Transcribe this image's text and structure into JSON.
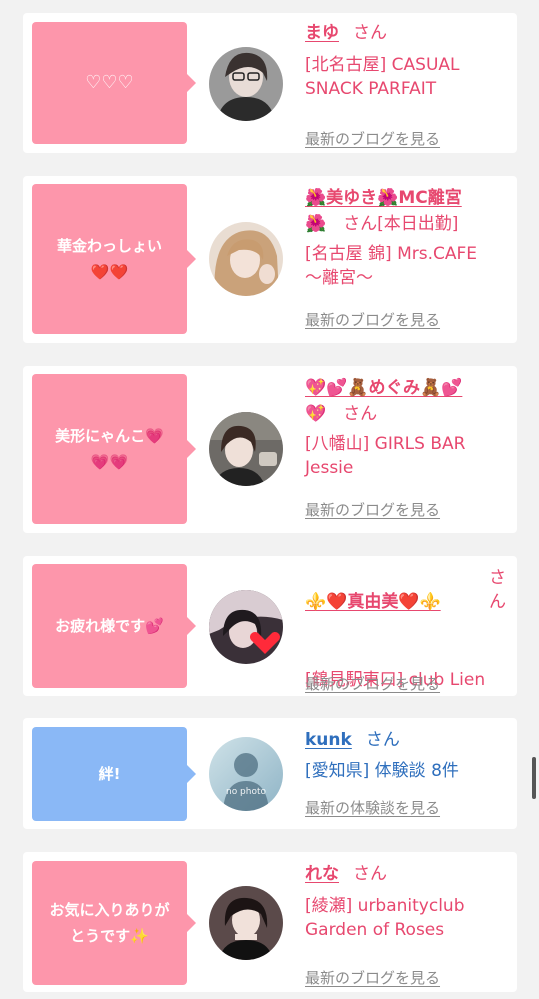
{
  "entries": [
    {
      "message": "♡♡♡",
      "name": "まゆ",
      "honorific": "さん",
      "shop": "[北名古屋] CASUAL\nSNACK PARFAIT",
      "link": "最新のブログを見る"
    },
    {
      "message": "華金わっしょい\n❤️❤️",
      "name": "🌺美ゆき🌺MC離宮",
      "honorific": "🌺　さん[本日出勤]",
      "shop": "[名古屋 錦] Mrs.CAFE\n〜離宮〜",
      "link": "最新のブログを見る"
    },
    {
      "message": "美形にゃんこ💗\n💗💗",
      "name": "💖💕🧸めぐみ🧸💕",
      "honorific": "💖　さん",
      "shop": "[八幡山] GIRLS BAR\nJessie",
      "link": "最新のブログを見る"
    },
    {
      "message": "お疲れ様です💕",
      "name": "⚜️❤️真由美❤️⚜️",
      "honorific": "さ\nん",
      "shop": "[鶴見駅東口] club Lien",
      "link": "最新のブログを見る"
    },
    {
      "message": "絆!",
      "name": "kunk",
      "honorific": "さん",
      "shop": "[愛知県] 体験談 8件",
      "link": "最新の体験談を見る",
      "avatar_text": "no photo"
    },
    {
      "message": "お気に入りありが\nとうです✨",
      "name": "れな",
      "honorific": "さん",
      "shop": "[綾瀬] urbanityclub\nGarden of Roses",
      "link": "最新のブログを見る"
    }
  ],
  "colors": {
    "pink_bubble": "#fd96ab",
    "blue_bubble": "#8ab8f6",
    "pink_text": "#e7486f",
    "blue_text": "#2f6fbd",
    "link_gray": "#8b8b8b"
  }
}
